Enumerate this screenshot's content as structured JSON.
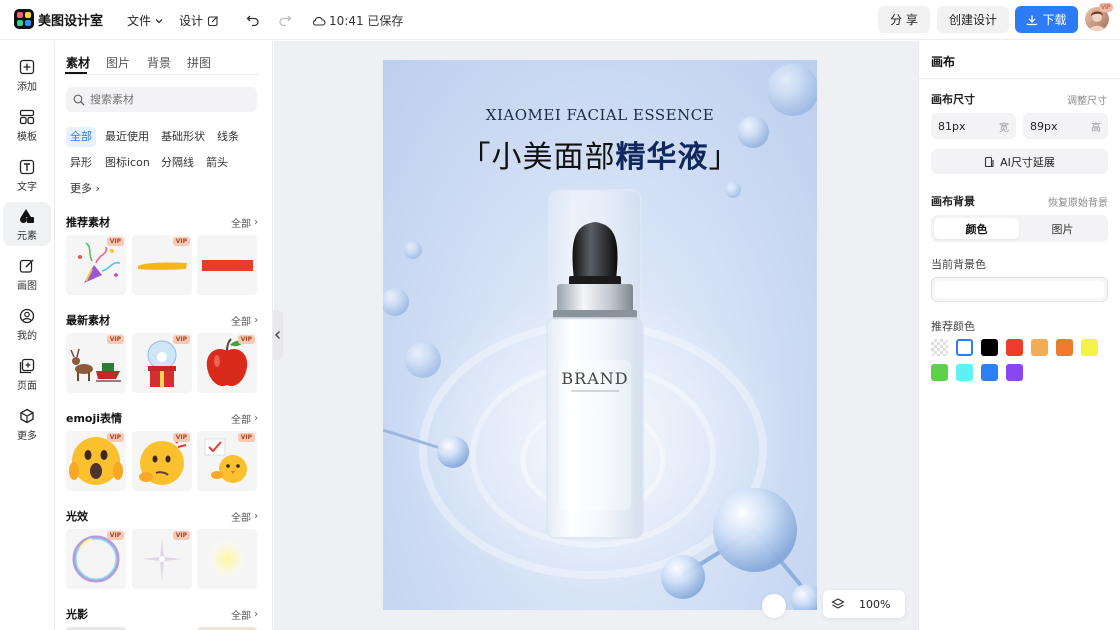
{
  "app": {
    "name": "美图设计室"
  },
  "topbar": {
    "menu_file": "文件",
    "menu_design": "设计",
    "save_status": "10:41 已保存",
    "share": "分 享",
    "create_design": "创建设计",
    "download": "下载",
    "avatar_badge": "VIP"
  },
  "rail": {
    "items": [
      {
        "label": "添加",
        "icon": "plus-square-icon"
      },
      {
        "label": "模板",
        "icon": "template-grid-icon"
      },
      {
        "label": "文字",
        "icon": "text-icon"
      },
      {
        "label": "元素",
        "icon": "shapes-icon"
      },
      {
        "label": "画图",
        "icon": "pencil-edit-icon"
      },
      {
        "label": "我的",
        "icon": "user-icon"
      },
      {
        "label": "页面",
        "icon": "add-page-icon"
      },
      {
        "label": "更多",
        "icon": "cube-icon"
      }
    ],
    "active_index": 3
  },
  "panel": {
    "tabs": [
      "素材",
      "图片",
      "背景",
      "拼图"
    ],
    "active_tab": 0,
    "search_placeholder": "搜索素材",
    "chips": [
      "全部",
      "最近使用",
      "基础形状",
      "线条",
      "异形",
      "图标icon",
      "分隔线",
      "箭头",
      "更多"
    ],
    "active_chip": 0,
    "all_label": "全部",
    "vip_label": "VIP",
    "sections": [
      {
        "title": "推荐素材",
        "items": [
          "party-popper",
          "yellow-brush-stroke",
          "red-bar"
        ]
      },
      {
        "title": "最新素材",
        "items": [
          "reindeer-sleigh",
          "snow-globe-gift",
          "red-apple"
        ]
      },
      {
        "title": "emoji表情",
        "items": [
          "shocked-emoji",
          "thinking-emoji",
          "chick-emoji"
        ]
      },
      {
        "title": "光效",
        "items": [
          "bubble-ring",
          "sparkle-flare",
          "soft-glow"
        ]
      },
      {
        "title": "光影",
        "items": []
      }
    ]
  },
  "canvas": {
    "poster_en": "XIAOMEI FACIAL ESSENCE",
    "poster_cn_prefix": "「小美面部",
    "poster_cn_highlight": "精华液",
    "poster_cn_suffix": "」",
    "bottle_brand": "BRAND",
    "zoom": "100%"
  },
  "right_panel": {
    "title": "画布",
    "size_label": "画布尺寸",
    "adjust_size": "调整尺寸",
    "width_value": "81px",
    "width_unit": "宽",
    "height_value": "89px",
    "height_unit": "高",
    "ai_extend": "AI尺寸延展",
    "bg_label": "画布背景",
    "restore_bg": "恢复原始背景",
    "seg_color": "颜色",
    "seg_image": "图片",
    "current_bg_label": "当前背景色",
    "current_bg_color": "#ffffff",
    "recommend_label": "推荐颜色",
    "swatches": [
      "transparent",
      "#ffffff",
      "#000000",
      "#ee3b2b",
      "#f5ad55",
      "#f07b2c",
      "#f4f442",
      "#5dd14a",
      "#5ef1ef",
      "#2b80f3",
      "#8a47f0"
    ]
  },
  "colors": {
    "primary": "#2d7cf6",
    "accent_title": "#10285c"
  }
}
